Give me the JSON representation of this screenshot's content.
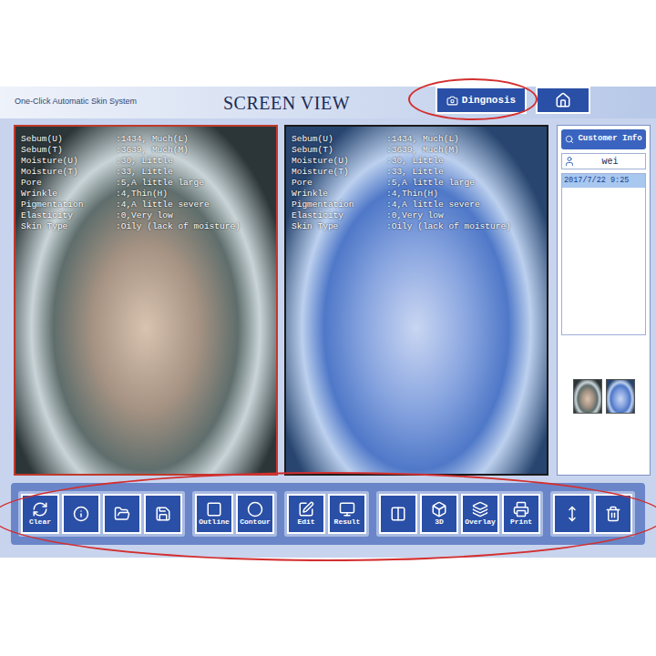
{
  "app": {
    "subtitle": "One-Click Automatic Skin System",
    "title": "SCREEN VIEW"
  },
  "diagnosis_button": {
    "label": "Dingnosis"
  },
  "readings": [
    {
      "label": "Sebum(U)",
      "value": ":1434, Much(L)"
    },
    {
      "label": "Sebum(T)",
      "value": ":3639, Much(M)"
    },
    {
      "label": "Moisture(U)",
      "value": ":30, Little"
    },
    {
      "label": "Moisture(T)",
      "value": ":33, Little"
    },
    {
      "label": "Pore",
      "value": ":5,A little large"
    },
    {
      "label": "Wrinkle",
      "value": ":4,Thin(H)"
    },
    {
      "label": "Pigmentation",
      "value": ":4,A little severe"
    },
    {
      "label": "Elasticity",
      "value": ":0,Very low"
    },
    {
      "label": "Skin Type",
      "value": ":Oily (lack of moisture)"
    }
  ],
  "panels": [
    {
      "kind": "normal",
      "selected": true
    },
    {
      "kind": "uv",
      "selected": false
    }
  ],
  "customer": {
    "button": "Customer Info",
    "name": "wei",
    "records": [
      {
        "label": "2017/7/22 9:25",
        "selected": true
      }
    ]
  },
  "toolbar": {
    "groups": [
      {
        "buttons": [
          {
            "kind": "clear",
            "label": "Clear"
          },
          {
            "kind": "info"
          },
          {
            "kind": "open"
          },
          {
            "kind": "save"
          }
        ]
      },
      {
        "buttons": [
          {
            "kind": "outline",
            "label": "Outline"
          },
          {
            "kind": "contour",
            "label": "Contour"
          }
        ]
      },
      {
        "buttons": [
          {
            "kind": "edit",
            "label": "Edit"
          },
          {
            "kind": "result",
            "label": "Result"
          }
        ]
      },
      {
        "buttons": [
          {
            "kind": "split"
          },
          {
            "kind": "3d",
            "label": "3D"
          },
          {
            "kind": "overlay",
            "label": "Overlay"
          },
          {
            "kind": "print",
            "label": "Print"
          }
        ]
      },
      {
        "buttons": [
          {
            "kind": "resize"
          },
          {
            "kind": "delete"
          }
        ]
      }
    ]
  }
}
